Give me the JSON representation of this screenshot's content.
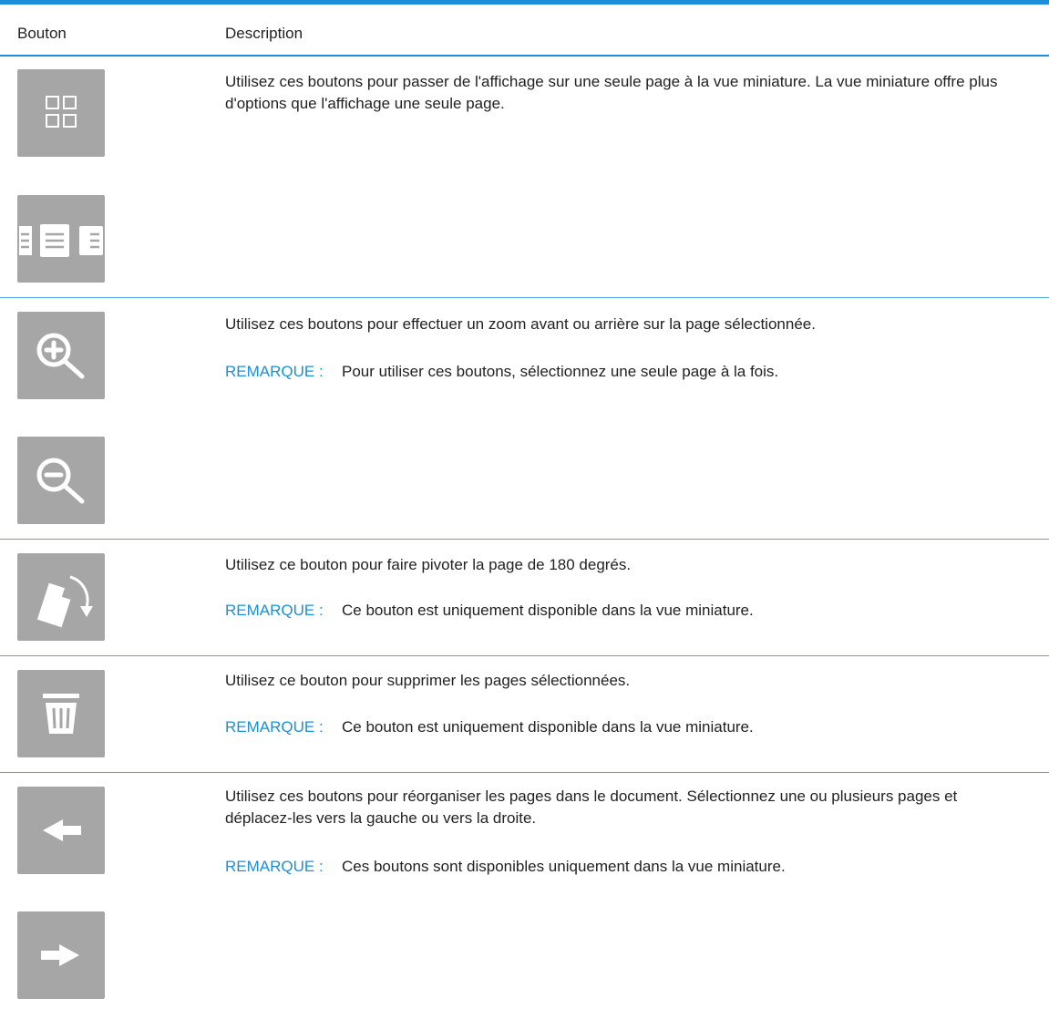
{
  "header": {
    "col_button": "Bouton",
    "col_description": "Description"
  },
  "note_label": "REMARQUE :",
  "rows": [
    {
      "description": "Utilisez ces boutons pour passer de l'affichage sur une seule page à la vue miniature. La vue miniature offre plus d'options que l'affichage une seule page.",
      "note": "",
      "icons": [
        "thumbnail-view-icon",
        "single-page-view-icon"
      ]
    },
    {
      "description": "Utilisez ces boutons pour effectuer un zoom avant ou arrière sur la page sélectionnée.",
      "note": "Pour utiliser ces boutons, sélectionnez une seule page à la fois.",
      "icons": [
        "zoom-in-icon",
        "zoom-out-icon"
      ]
    },
    {
      "description": "Utilisez ce bouton pour faire pivoter la page de 180 degrés.",
      "note": "Ce bouton est uniquement disponible dans la vue miniature.",
      "icons": [
        "rotate-page-icon"
      ]
    },
    {
      "description": "Utilisez ce bouton pour supprimer les pages sélectionnées.",
      "note": "Ce bouton est uniquement disponible dans la vue miniature.",
      "icons": [
        "trash-icon"
      ]
    },
    {
      "description": "Utilisez ces boutons pour réorganiser les pages dans le document. Sélectionnez une ou plusieurs pages et déplacez-les vers la gauche ou vers la droite.",
      "note": "Ces boutons sont disponibles uniquement dans la vue miniature.",
      "icons": [
        "arrow-left-icon",
        "arrow-right-icon"
      ]
    }
  ],
  "colors": {
    "accent": "#1d8fd6",
    "button_bg": "#a6a6a6",
    "icon": "#ffffff"
  }
}
